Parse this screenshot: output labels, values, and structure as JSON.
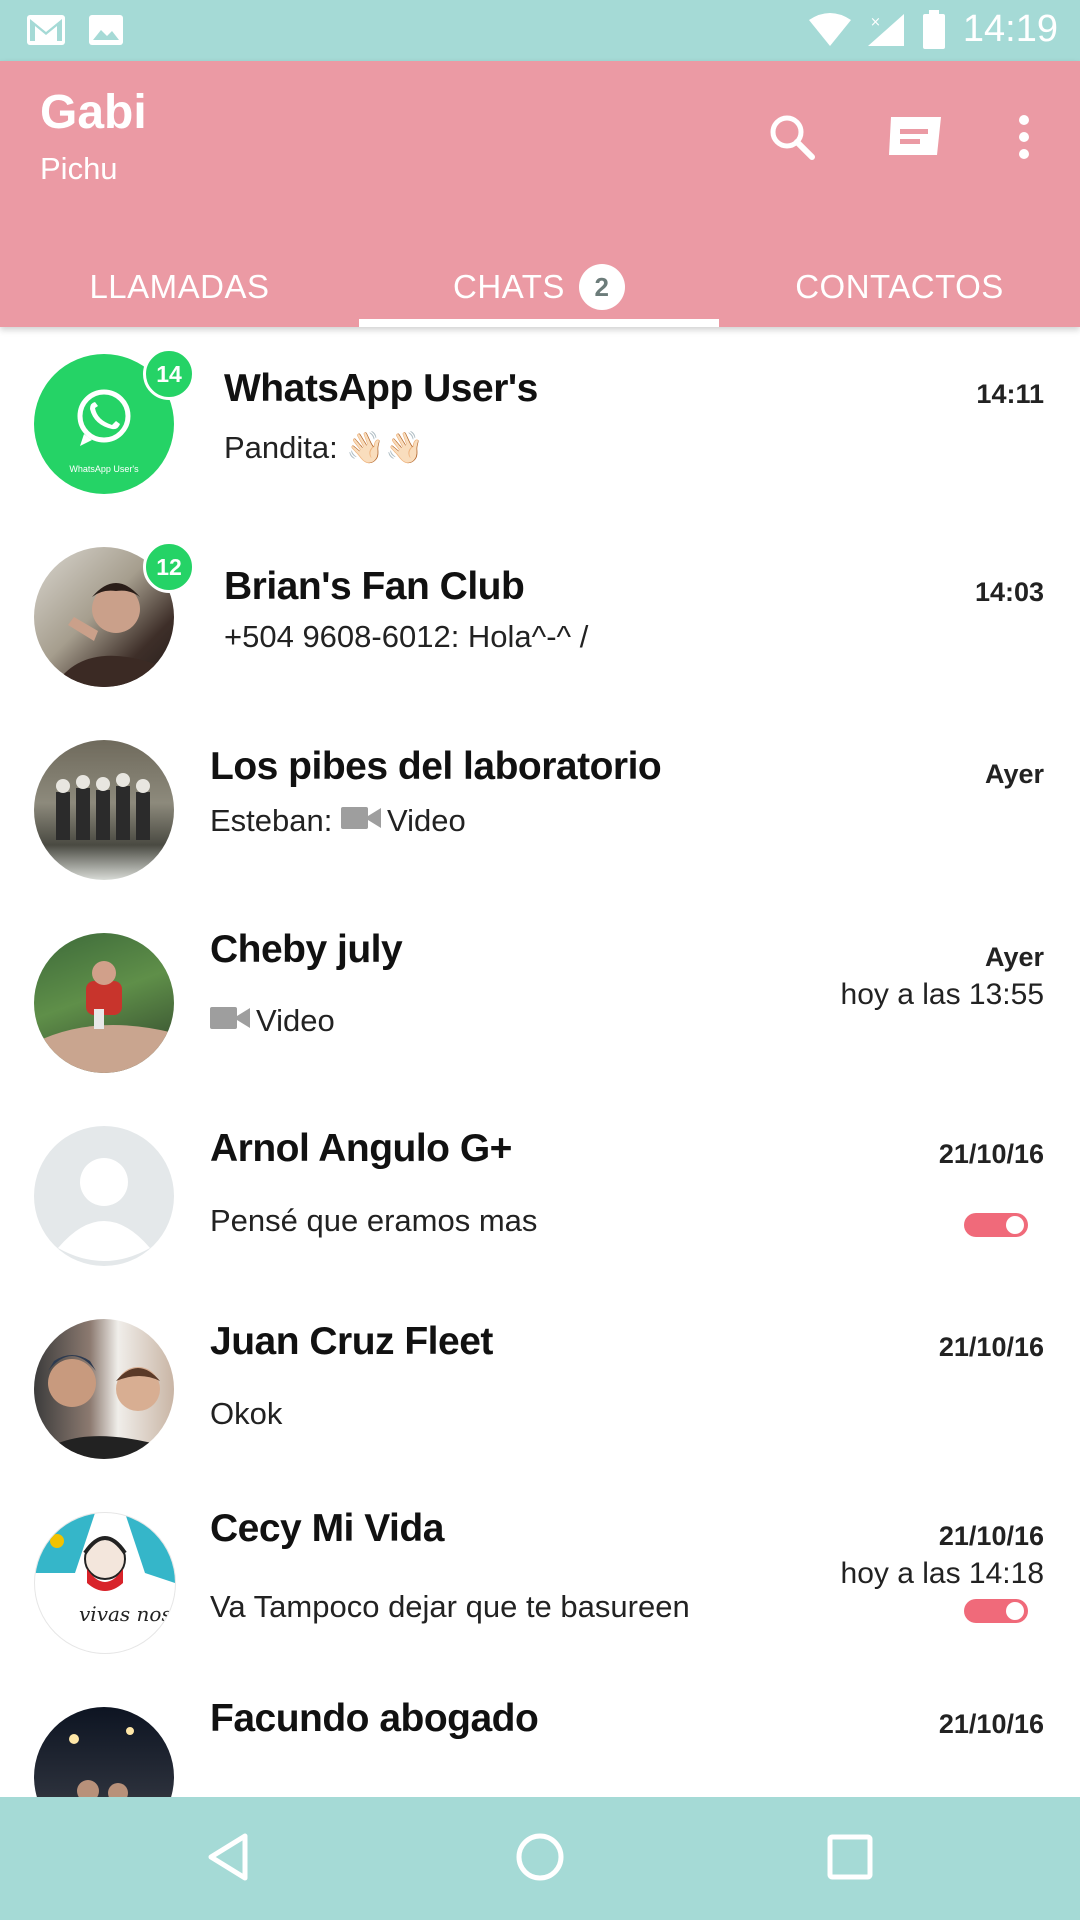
{
  "status_bar": {
    "time": "14:19",
    "icons": [
      "gmail-icon",
      "image-icon",
      "wifi-icon",
      "signal-icon",
      "battery-icon"
    ]
  },
  "header": {
    "title": "Gabi",
    "subtitle": "Pichu",
    "actions": [
      "search-icon",
      "new-message-icon",
      "more-vert-icon"
    ],
    "color": "#eb9aa4"
  },
  "tabs": [
    {
      "label": "LLAMADAS"
    },
    {
      "label": "CHATS",
      "badge": "2",
      "active": true
    },
    {
      "label": "CONTACTOS"
    }
  ],
  "chats": [
    {
      "name": "WhatsApp User's",
      "preview": "Pandita: 👋🏻👋🏻",
      "time": "14:11",
      "unread": "14",
      "avatar_caption": "WhatsApp User's"
    },
    {
      "name": "Brian's Fan Club",
      "preview": "+504 9608-6012: Hola^-^ /",
      "time": "14:03",
      "unread": "12"
    },
    {
      "name": "Los pibes del laboratorio",
      "sender": "Esteban:",
      "preview": "Video",
      "time": "Ayer"
    },
    {
      "name": "Cheby july",
      "preview": "Video",
      "time": "Ayer",
      "subtime": "hoy a las 13:55"
    },
    {
      "name": "Arnol Angulo G+",
      "preview": "Pensé que eramos mas",
      "time": "21/10/16"
    },
    {
      "name": "Juan Cruz Fleet",
      "preview": "Okok",
      "time": "21/10/16"
    },
    {
      "name": "Cecy Mi Vida",
      "preview": "Va Tampoco dejar que te basureen",
      "time": "21/10/16",
      "subtime": "hoy a las 14:18",
      "avatar_text": "vivas nos"
    },
    {
      "name": "Facundo abogado",
      "preview": "",
      "time": "21/10/16"
    }
  ],
  "navbar": [
    "back-icon",
    "home-icon",
    "recents-icon"
  ],
  "colors": {
    "accent": "#eb9aa4",
    "bars": "#a5dad6",
    "unread": "#25d366",
    "toggle": "#f06a7a"
  }
}
